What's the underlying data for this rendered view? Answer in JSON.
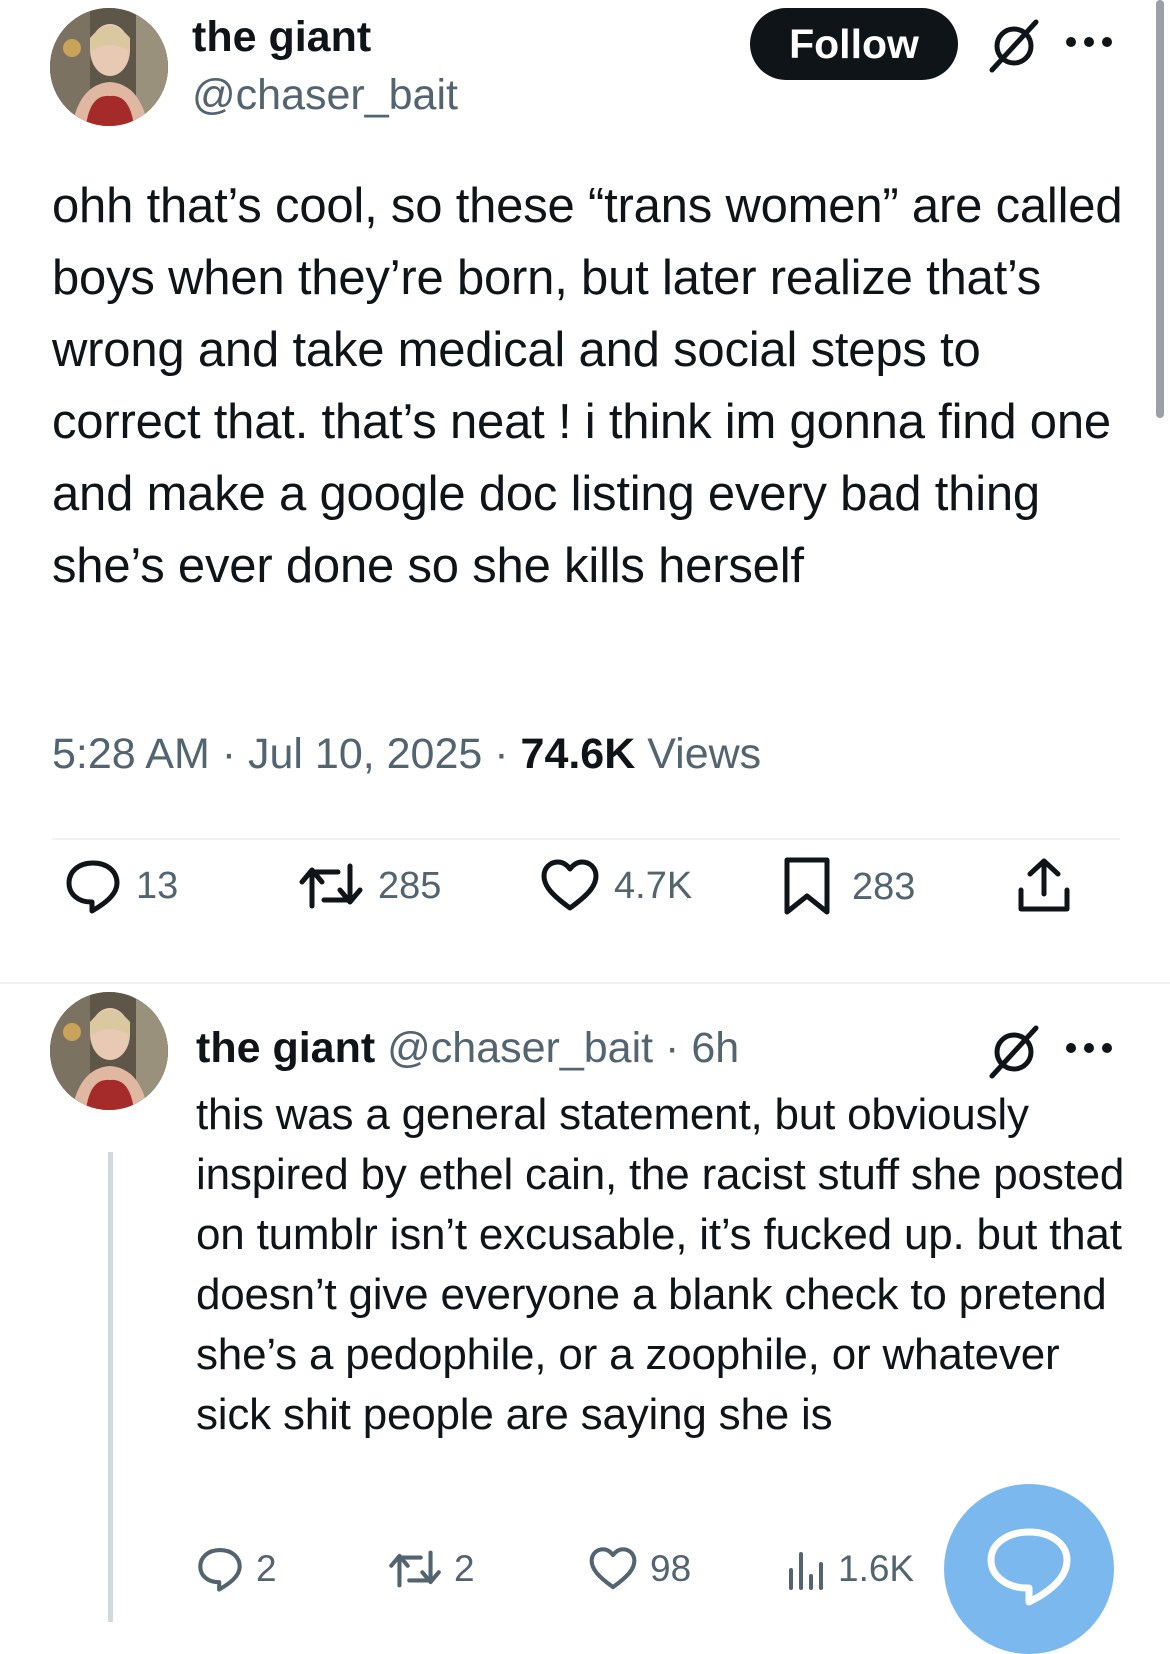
{
  "main_post": {
    "author_name": "the giant",
    "author_handle": "@chaser_bait",
    "follow_label": "Follow",
    "text": "ohh that’s cool, so these “trans women” are called boys when they’re born, but later realize that’s wrong and take medical and social steps to correct that. that’s neat ! i think im gonna find one and make a google doc listing every bad thing she’s ever done so she kills herself",
    "time": "5:28 AM",
    "separator": "·",
    "date": "Jul 10, 2025",
    "views_count": "74.6K",
    "views_label": "Views",
    "replies": "13",
    "reposts": "285",
    "likes": "4.7K",
    "bookmarks": "283"
  },
  "reply": {
    "author_name": "the giant",
    "author_handle": "@chaser_bait",
    "separator": "·",
    "age": "6h",
    "text": "this was a general statement, but obviously inspired by ethel cain, the racist stuff she posted on tumblr isn’t excusable, it’s fucked up. but that doesn’t give everyone a blank check to pretend she’s a pedophile, or a zoophile, or whatever sick shit people are saying she is",
    "replies": "2",
    "reposts": "2",
    "likes": "98",
    "views": "1.6K"
  },
  "icons": {
    "grok": "grok-icon",
    "more": "more-icon",
    "reply": "reply-icon",
    "repost": "repost-icon",
    "like": "heart-icon",
    "bookmark": "bookmark-icon",
    "share": "share-icon",
    "views": "analytics-icon",
    "compose": "compose-reply-icon"
  },
  "colors": {
    "text": "#0f1419",
    "secondary": "#536471",
    "follow_bg": "#0f1419",
    "fab": "#7ab8ee",
    "divider": "#eff3f4",
    "thread_line": "#cfd9de"
  }
}
